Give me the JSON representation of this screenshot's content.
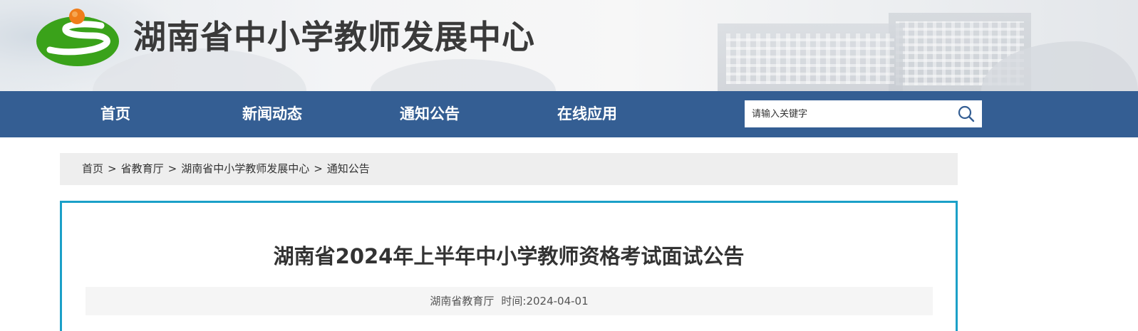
{
  "header": {
    "site_title": "湖南省中小学教师发展中心",
    "logo_icon": "green-s-road-logo",
    "colors": {
      "logo_green": "#3aa21a",
      "logo_orange": "#ef7d1a"
    }
  },
  "nav": {
    "items": [
      {
        "label": "首页"
      },
      {
        "label": "新闻动态"
      },
      {
        "label": "通知公告"
      },
      {
        "label": "在线应用"
      }
    ],
    "background": "#345e93",
    "search": {
      "placeholder": "请输入关键字",
      "icon": "search-icon"
    }
  },
  "breadcrumb": {
    "items": [
      {
        "label": "首页"
      },
      {
        "label": "省教育厅"
      },
      {
        "label": "湖南省中小学教师发展中心"
      },
      {
        "label": "通知公告"
      }
    ],
    "separator": ">"
  },
  "article": {
    "title": "湖南省2024年上半年中小学教师资格考试面试公告",
    "source": "湖南省教育厅",
    "time_label": "时间:",
    "time": "2024-04-01",
    "border_color": "#1ba0c8"
  }
}
